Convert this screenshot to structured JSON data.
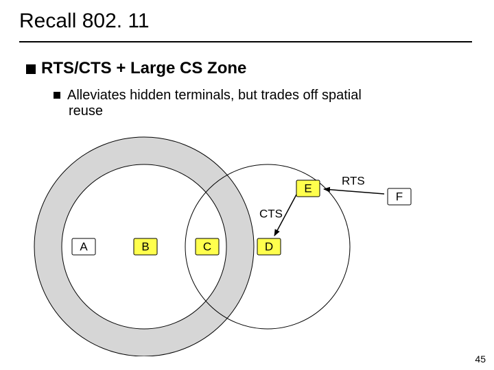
{
  "title": "Recall 802. 11",
  "bullets": {
    "l1": "RTS/CTS + Large CS Zone",
    "l2_line1": "Alleviates hidden terminals, but trades off spatial",
    "l2_line2": "reuse"
  },
  "diagram": {
    "nodes": {
      "A": {
        "label": "A",
        "fill": "#ffffff"
      },
      "B": {
        "label": "B",
        "fill": "#ffff4d"
      },
      "C": {
        "label": "C",
        "fill": "#ffff4d"
      },
      "D": {
        "label": "D",
        "fill": "#ffff4d"
      },
      "E": {
        "label": "E",
        "fill": "#ffff4d"
      },
      "F": {
        "label": "F",
        "fill": "#ffffff"
      }
    },
    "edges": {
      "rts": "RTS",
      "cts": "CTS"
    }
  },
  "page_number": "45",
  "chart_data": {
    "type": "diagram",
    "description": "802.11 RTS/CTS with large carrier-sense zone. Two overlapping carrier-sense circles (around B and D), with a shaded annulus (CS zone) around B's circle. Nodes A..F in a row; E above D; RTS arrow from F toward E; CTS arrow from E toward D.",
    "nodes": [
      "A",
      "B",
      "C",
      "D",
      "E",
      "F"
    ],
    "arrows": [
      {
        "from": "F",
        "to": "E",
        "label": "RTS"
      },
      {
        "from": "E",
        "to": "D",
        "label": "CTS"
      }
    ],
    "carrier_sense_centers": [
      "B",
      "D"
    ],
    "shaded_cs_zone_center": "B"
  }
}
